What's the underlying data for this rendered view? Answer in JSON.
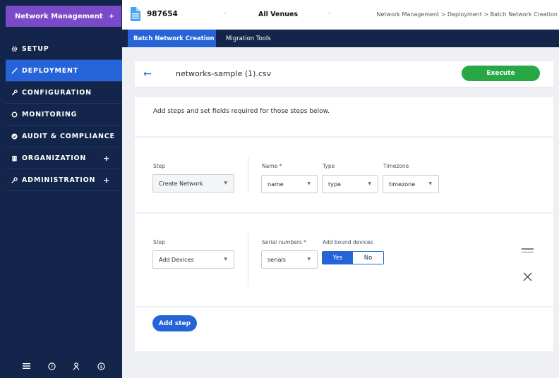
{
  "sidebar": {
    "header_label": "Network Management",
    "header_plus": "+",
    "items": [
      {
        "label": "SETUP",
        "icon": "gear-icon"
      },
      {
        "label": "DEPLOYMENT",
        "icon": "wand-icon",
        "active": true
      },
      {
        "label": "CONFIGURATION",
        "icon": "wrench-icon"
      },
      {
        "label": "MONITORING",
        "icon": "ring-icon"
      },
      {
        "label": "AUDIT & COMPLIANCE",
        "icon": "check-circle-icon"
      },
      {
        "label": "ORGANIZATION",
        "icon": "building-icon",
        "plus": "+"
      },
      {
        "label": "ADMINISTRATION",
        "icon": "key-icon",
        "plus": "+"
      }
    ],
    "footer_icons": [
      "menu-icon",
      "help-icon",
      "user-icon",
      "dollar-icon"
    ]
  },
  "topbar": {
    "account_id": "987654",
    "venue": "All Venues",
    "breadcrumb": "Network Management > Deployment > Batch Network Creation"
  },
  "tabs": [
    {
      "label": "Batch Network Creation",
      "active": true
    },
    {
      "label": "Migration Tools",
      "active": false
    }
  ],
  "main": {
    "file_title": "networks-sample (1).csv",
    "execute_label": "Execute",
    "intro": "Add steps and set fields required for those steps below.",
    "step1": {
      "step_label": "Step",
      "step_value": "Create Network",
      "fields": [
        {
          "label": "Name *",
          "value": "name"
        },
        {
          "label": "Type",
          "value": "type"
        },
        {
          "label": "Timezone",
          "value": "timezone"
        }
      ]
    },
    "step2": {
      "step_label": "Step",
      "step_value": "Add Devices",
      "serial_label": "Serial numbers *",
      "serial_value": "serials",
      "bound_label": "Add bound devices",
      "toggle_yes": "Yes",
      "toggle_no": "No",
      "toggle_selected": "Yes"
    },
    "add_step_label": "Add step"
  },
  "colors": {
    "sidebar_bg": "#13254a",
    "header_purple": "#7a4ac8",
    "accent_blue": "#2463d8",
    "execute_green": "#28a745"
  }
}
